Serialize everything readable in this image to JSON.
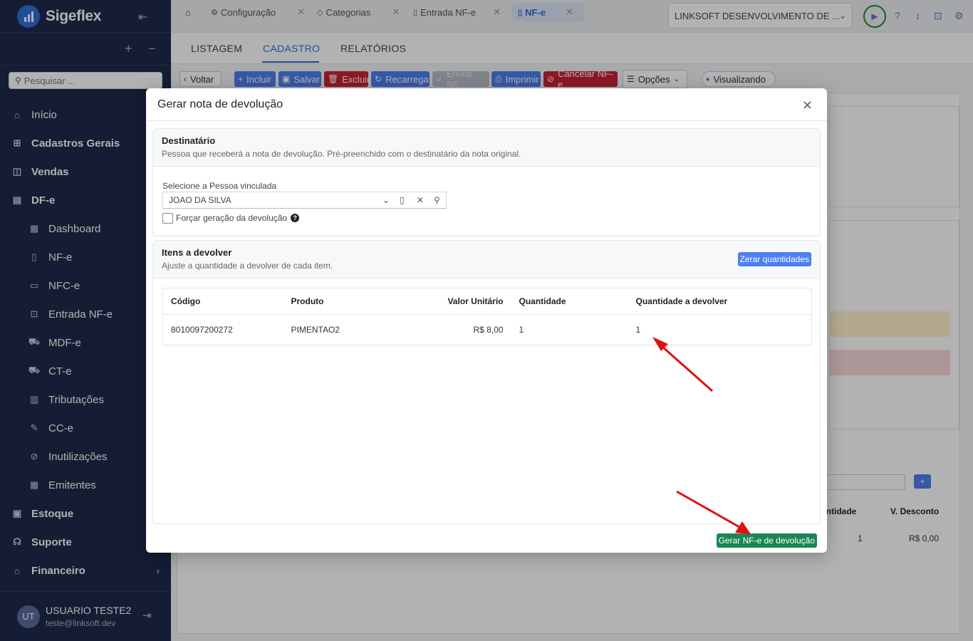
{
  "app": {
    "brand": "Sigeflex",
    "search_placeholder": "Pesquisar ..."
  },
  "sidebar": {
    "items": [
      {
        "label": "Início",
        "icon": "home-icon"
      },
      {
        "label": "Cadastros Gerais",
        "icon": "grid-icon"
      },
      {
        "label": "Vendas",
        "icon": "bag-icon"
      },
      {
        "label": "DF-e",
        "icon": "document-icon"
      },
      {
        "label": "Dashboard",
        "icon": "dashboard-icon"
      },
      {
        "label": "NF-e",
        "icon": "file-icon"
      },
      {
        "label": "NFC-e",
        "icon": "receipt-icon"
      },
      {
        "label": "Entrada NF-e",
        "icon": "file-import-icon"
      },
      {
        "label": "MDF-e",
        "icon": "truck-icon"
      },
      {
        "label": "CT-e",
        "icon": "truck-icon"
      },
      {
        "label": "Tributações",
        "icon": "calculator-icon"
      },
      {
        "label": "CC-e",
        "icon": "edit-file-icon"
      },
      {
        "label": "Inutilizações",
        "icon": "ban-icon"
      },
      {
        "label": "Emitentes",
        "icon": "building-icon"
      },
      {
        "label": "Estoque",
        "icon": "box-icon"
      },
      {
        "label": "Suporte",
        "icon": "headset-icon"
      },
      {
        "label": "Financeiro",
        "icon": "bank-icon"
      }
    ],
    "user": {
      "initials": "UT",
      "name": "USUARIO TESTE2",
      "email": "teste@linksoft.dev"
    }
  },
  "topbar": {
    "tabs": [
      {
        "label": "Configuração"
      },
      {
        "label": "Categorias"
      },
      {
        "label": "Entrada NF-e"
      },
      {
        "label": "NF-e"
      }
    ],
    "company": "LINKSOFT DESENVOLVIMENTO DE ..."
  },
  "page": {
    "tabs": [
      "LISTAGEM",
      "CADASTRO",
      "RELATÓRIOS"
    ],
    "toolbar": {
      "back": "Voltar",
      "incluir": "Incluir",
      "salvar": "Salvar",
      "excluir": "Excluir",
      "recarrega": "Recarrega",
      "enviar": "Enviar NF",
      "imprimir": "Imprimir",
      "cancelar": "Cancelar NF-e",
      "opcoes": "Opções",
      "status": "Visualizando"
    },
    "background_table": {
      "col_qty": "antidade",
      "col_discount": "V. Desconto",
      "qty": "1",
      "discount": "R$ 0,00"
    }
  },
  "modal": {
    "title": "Gerar nota de devolução",
    "recipient": {
      "title": "Destinatário",
      "subtitle": "Pessoa que receberá a nota de devolução. Pré-preenchido com o destinatário da nota original.",
      "field_label": "Selecione a Pessoa vinculada",
      "field_value": "JOAO DA SILVA",
      "force_label": "Forçar geração da devolução"
    },
    "items": {
      "title": "Itens a devolver",
      "subtitle": "Ajuste a quantidade a devolver de cada item.",
      "reset_button": "Zerar quantidades",
      "columns": [
        "Código",
        "Produto",
        "Valor Unitário",
        "Quantidade",
        "Quantidade a devolver"
      ],
      "rows": [
        {
          "codigo": "8010097200272",
          "produto": "PIMENTAO2",
          "valor": "R$ 8,00",
          "quantidade": "1",
          "devolver": "1"
        }
      ]
    },
    "generate_button": "Gerar NF-e de devolução"
  },
  "colors": {
    "sidebar": "#1e2a4a",
    "primary": "#2e6fd8",
    "danger": "#c82333",
    "success": "#198754",
    "arrow": "#e01010"
  }
}
